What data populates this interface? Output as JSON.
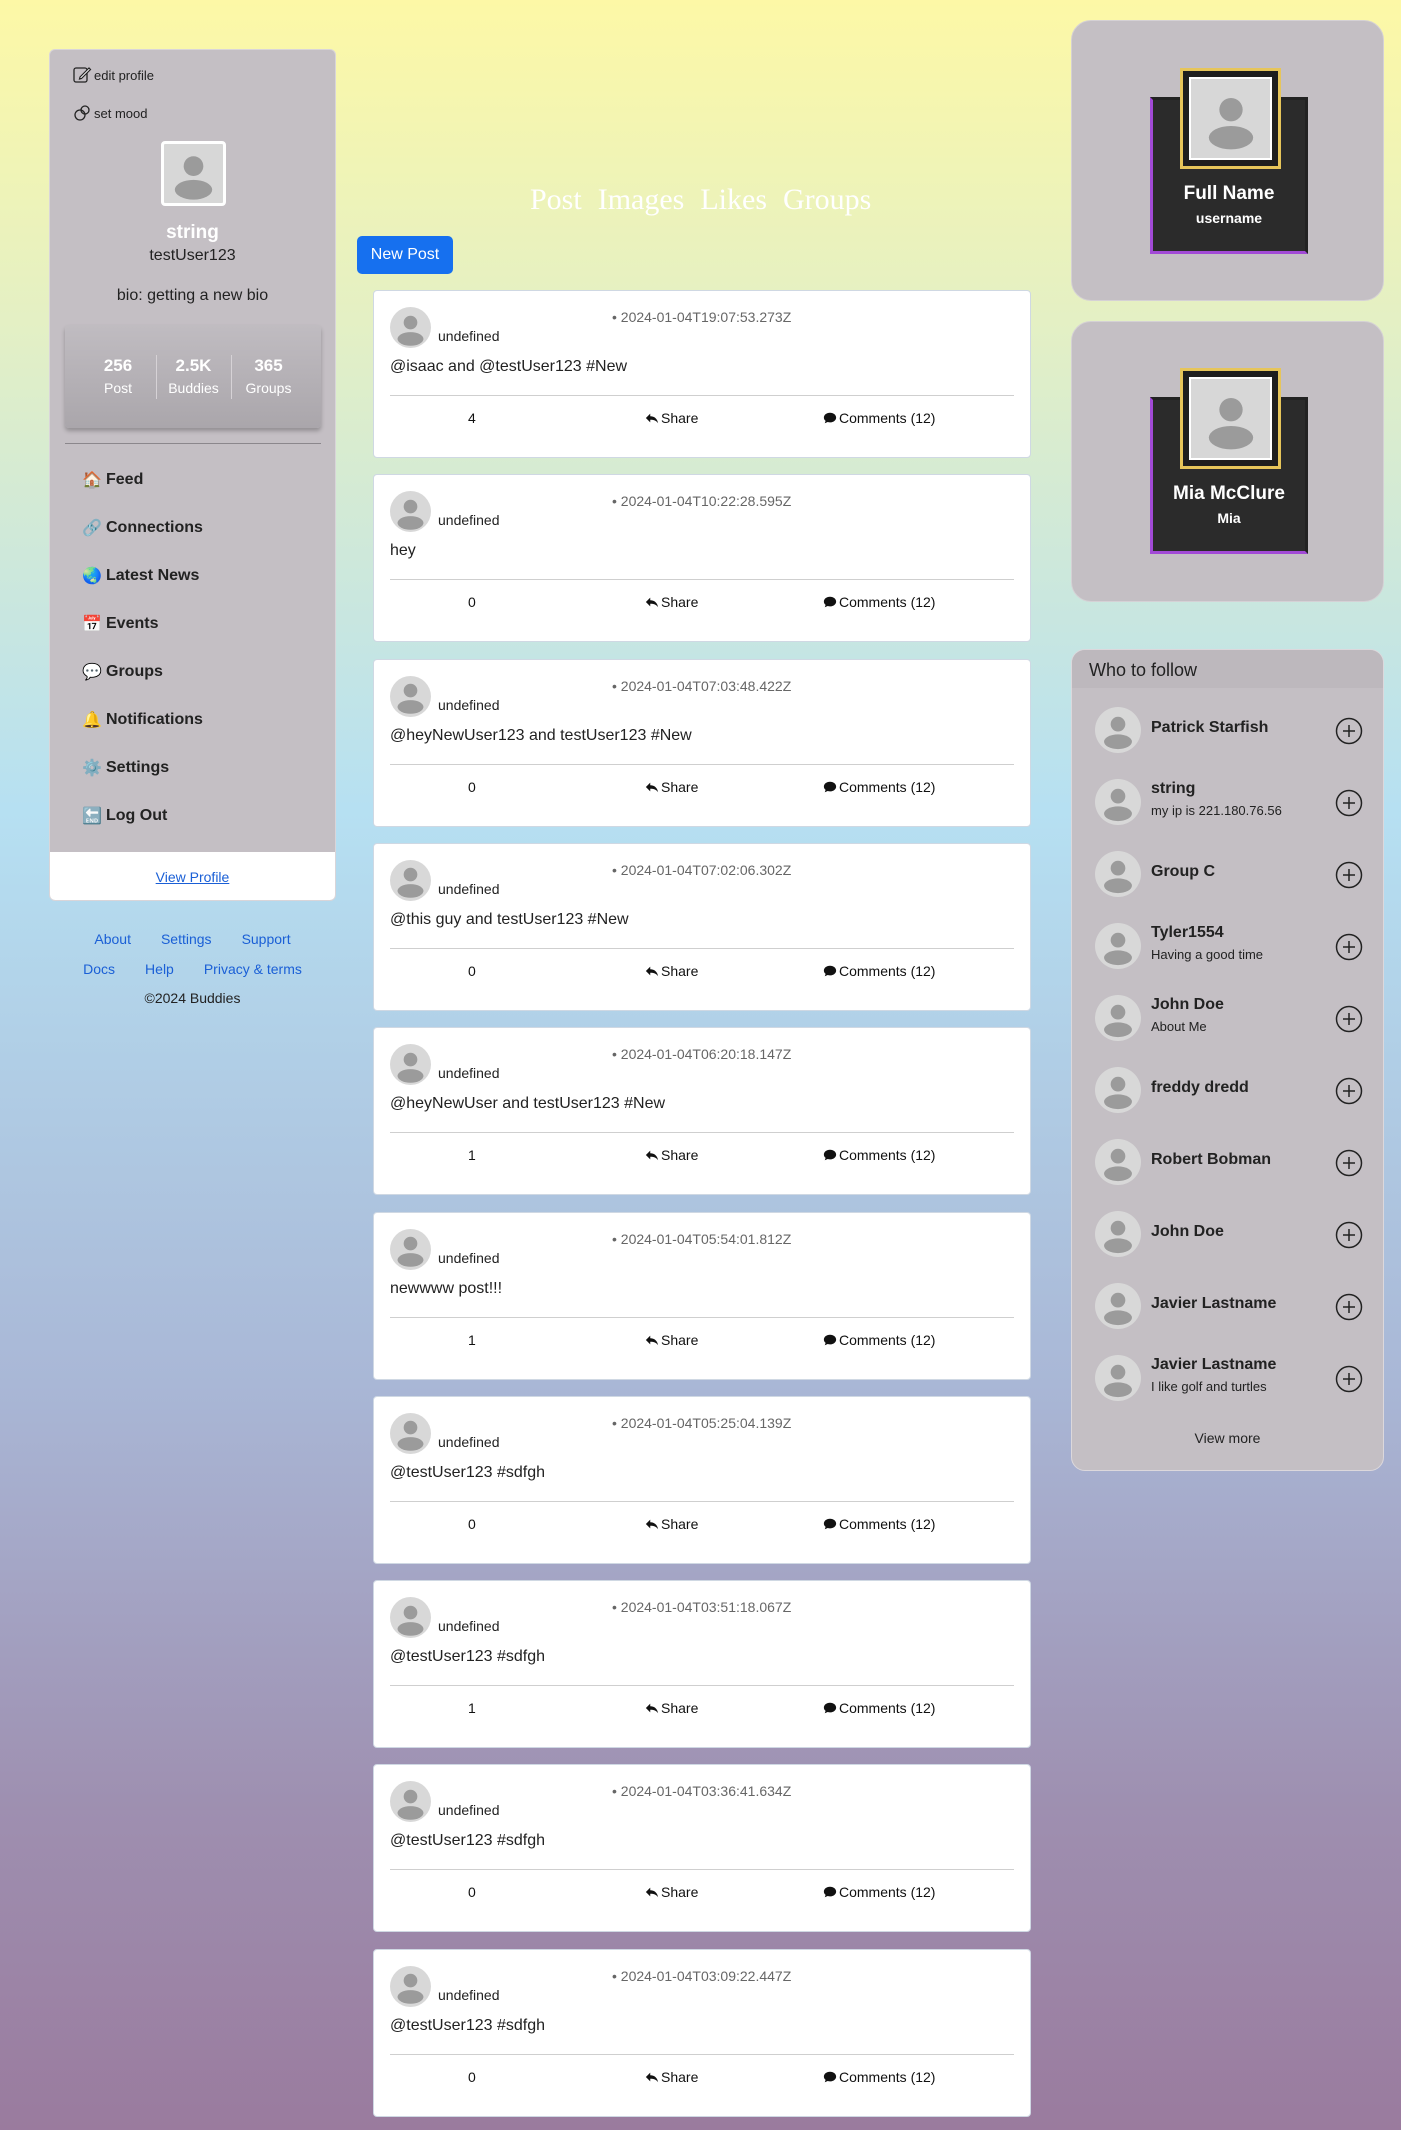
{
  "profile": {
    "edit_profile": "edit profile",
    "set_mood": "set mood",
    "name": "string",
    "username": "testUser123",
    "bio": "bio: getting a new bio",
    "stats": [
      {
        "num": "256",
        "label": "Post"
      },
      {
        "num": "2.5K",
        "label": "Buddies"
      },
      {
        "num": "365",
        "label": "Groups"
      }
    ],
    "view_profile": "View Profile"
  },
  "nav": [
    {
      "emoji": "🏠",
      "label": "Feed"
    },
    {
      "emoji": "🔗",
      "label": "Connections"
    },
    {
      "emoji": "🌏",
      "label": "Latest News"
    },
    {
      "emoji": "📅",
      "label": "Events"
    },
    {
      "emoji": "💬",
      "label": "Groups"
    },
    {
      "emoji": "🔔",
      "label": "Notifications"
    },
    {
      "emoji": "⚙️",
      "label": "Settings"
    },
    {
      "emoji": "🔚",
      "label": "Log Out"
    }
  ],
  "footer": {
    "row1": [
      "About",
      "Settings",
      "Support"
    ],
    "row2": [
      "Docs",
      "Help",
      "Privacy & terms"
    ],
    "copyright": "©2024 Buddies"
  },
  "tabs": [
    "Post",
    "Images",
    "Likes",
    "Groups"
  ],
  "new_post": "New Post",
  "posts": [
    {
      "user": "undefined",
      "time": "• 2024-01-04T19:07:53.273Z",
      "text": "@isaac and @testUser123 #New",
      "likes": "4",
      "share": "Share",
      "comments": "Comments (12)"
    },
    {
      "user": "undefined",
      "time": "• 2024-01-04T10:22:28.595Z",
      "text": "hey",
      "likes": "0",
      "share": "Share",
      "comments": "Comments (12)"
    },
    {
      "user": "undefined",
      "time": "• 2024-01-04T07:03:48.422Z",
      "text": "@heyNewUser123 and testUser123 #New",
      "likes": "0",
      "share": "Share",
      "comments": "Comments (12)"
    },
    {
      "user": "undefined",
      "time": "• 2024-01-04T07:02:06.302Z",
      "text": "@this guy and testUser123 #New",
      "likes": "0",
      "share": "Share",
      "comments": "Comments (12)"
    },
    {
      "user": "undefined",
      "time": "• 2024-01-04T06:20:18.147Z",
      "text": "@heyNewUser and testUser123 #New",
      "likes": "1",
      "share": "Share",
      "comments": "Comments (12)"
    },
    {
      "user": "undefined",
      "time": "• 2024-01-04T05:54:01.812Z",
      "text": "newwww post!!!",
      "likes": "1",
      "share": "Share",
      "comments": "Comments (12)"
    },
    {
      "user": "undefined",
      "time": "• 2024-01-04T05:25:04.139Z",
      "text": "@testUser123 #sdfgh",
      "likes": "0",
      "share": "Share",
      "comments": "Comments (12)"
    },
    {
      "user": "undefined",
      "time": "• 2024-01-04T03:51:18.067Z",
      "text": "@testUser123 #sdfgh",
      "likes": "1",
      "share": "Share",
      "comments": "Comments (12)"
    },
    {
      "user": "undefined",
      "time": "• 2024-01-04T03:36:41.634Z",
      "text": "@testUser123 #sdfgh",
      "likes": "0",
      "share": "Share",
      "comments": "Comments (12)"
    },
    {
      "user": "undefined",
      "time": "• 2024-01-04T03:09:22.447Z",
      "text": "@testUser123 #sdfgh",
      "likes": "0",
      "share": "Share",
      "comments": "Comments (12)"
    }
  ],
  "cards": [
    {
      "name": "Full Name",
      "username": "username"
    },
    {
      "name": "Mia McClure",
      "username": "Mia"
    }
  ],
  "follow": {
    "title": "Who to follow",
    "items": [
      {
        "name": "Patrick Starfish",
        "sub": ""
      },
      {
        "name": "string",
        "sub": "my ip is 221.180.76.56"
      },
      {
        "name": "Group C",
        "sub": ""
      },
      {
        "name": "Tyler1554",
        "sub": "Having a good time"
      },
      {
        "name": "John Doe",
        "sub": "About Me"
      },
      {
        "name": "freddy dredd",
        "sub": ""
      },
      {
        "name": "Robert Bobman",
        "sub": ""
      },
      {
        "name": "John Doe",
        "sub": ""
      },
      {
        "name": "Javier Lastname",
        "sub": ""
      },
      {
        "name": "Javier Lastname",
        "sub": "I like golf and turtles"
      }
    ],
    "view_more": "View more"
  },
  "colors": {
    "accent": "#1670ef",
    "link": "#1a5fd6",
    "card": "#c4bfc4",
    "frame_gold": "#e6c55a",
    "frame_purple": "#a24ad6"
  }
}
